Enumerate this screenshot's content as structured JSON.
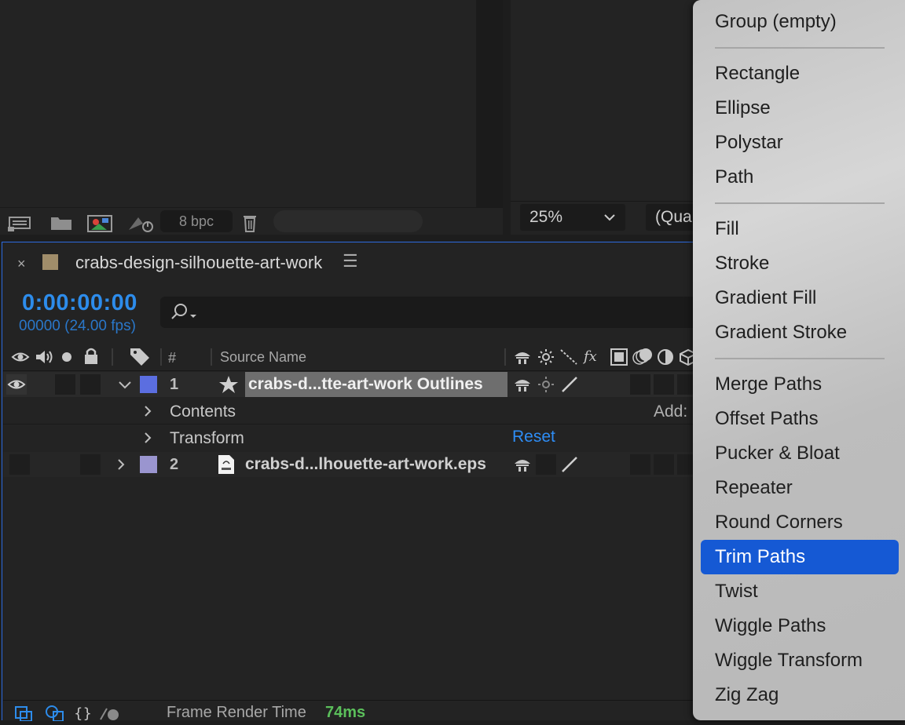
{
  "project_panel": {
    "bpc_label": "8 bpc"
  },
  "viewer": {
    "zoom": "25%",
    "quality": "(Qua"
  },
  "timeline": {
    "comp_name": "crabs-design-silhouette-art-work",
    "close_glyph": "×",
    "menu_glyph": "☰",
    "swatch_color": "#a08d6a",
    "timecode": "0:00:00:00",
    "frame_info": "00000 (24.00 fps)",
    "columns": {
      "number": "#",
      "source_name": "Source Name"
    },
    "layers": [
      {
        "number": "1",
        "name": "crabs-d...tte-art-work Outlines",
        "color": "#5b6ee0",
        "expanded": true
      },
      {
        "number": "2",
        "name": "crabs-d...lhouette-art-work.eps",
        "color": "#9a95cf",
        "expanded": false
      }
    ],
    "properties": {
      "contents": "Contents",
      "transform": "Transform",
      "reset": "Reset",
      "add": "Add:"
    },
    "status": {
      "frame_render_label": "Frame Render Time",
      "frame_render_value": "74ms"
    }
  },
  "add_menu": {
    "groups": [
      [
        "Group (empty)"
      ],
      [
        "Rectangle",
        "Ellipse",
        "Polystar",
        "Path"
      ],
      [
        "Fill",
        "Stroke",
        "Gradient Fill",
        "Gradient Stroke"
      ],
      [
        "Merge Paths",
        "Offset Paths",
        "Pucker & Bloat",
        "Repeater",
        "Round Corners",
        "Trim Paths",
        "Twist",
        "Wiggle Paths",
        "Wiggle Transform",
        "Zig Zag"
      ]
    ],
    "highlighted": "Trim Paths",
    "highlight_color": "#1559d4"
  }
}
